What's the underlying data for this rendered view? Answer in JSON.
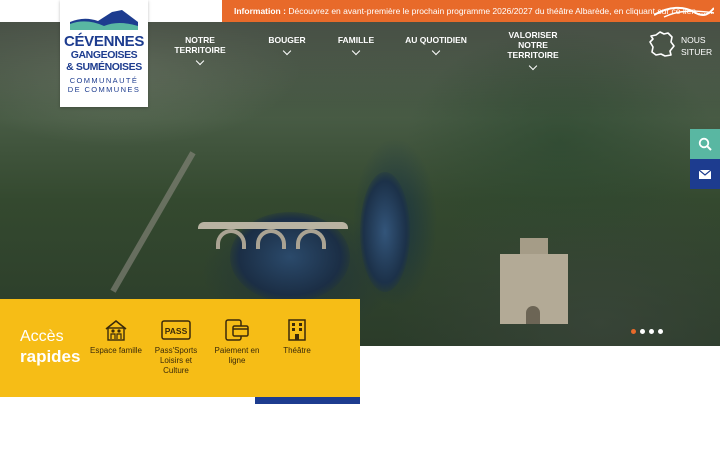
{
  "info_bar": {
    "label": "Information :",
    "text": "Découvrez en avant-première le prochain programme 2026/2027 du théâtre Albarède, en cliquant sur ce lien ......"
  },
  "logo": {
    "line1": "CÉVENNES",
    "line2": "GANGEOISES",
    "line3": "& SUMÉNOISES",
    "line4": "COMMUNAUTÉ",
    "line5": "DE COMMUNES"
  },
  "nav": [
    {
      "label": "NOTRE TERRITOIRE"
    },
    {
      "label": "BOUGER"
    },
    {
      "label": "FAMILLE"
    },
    {
      "label": "AU QUOTIDIEN"
    },
    {
      "label1": "VALORISER NOTRE",
      "label2": "TERRITOIRE"
    }
  ],
  "situer": {
    "line1": "NOUS",
    "line2": "SITUER"
  },
  "quick_access": {
    "title_light": "Accès",
    "title_bold": "rapides",
    "items": [
      {
        "label": "Espace famille",
        "icon": "family-house-icon"
      },
      {
        "line1": "Pass'Sports",
        "line2": "Loisirs et",
        "line3": "Culture",
        "icon": "pass-icon",
        "icon_text": "PASS"
      },
      {
        "line1": "Paiement en",
        "line2": "ligne",
        "icon": "online-payment-icon"
      },
      {
        "label": "Théâtre",
        "icon": "building-icon"
      }
    ]
  },
  "slider": {
    "count": 4,
    "active": 0
  },
  "colors": {
    "info_orange": "#e86a2a",
    "brand_blue": "#1d3c8f",
    "quick_yellow": "#f6bd16",
    "search_teal": "#59b7a2"
  }
}
